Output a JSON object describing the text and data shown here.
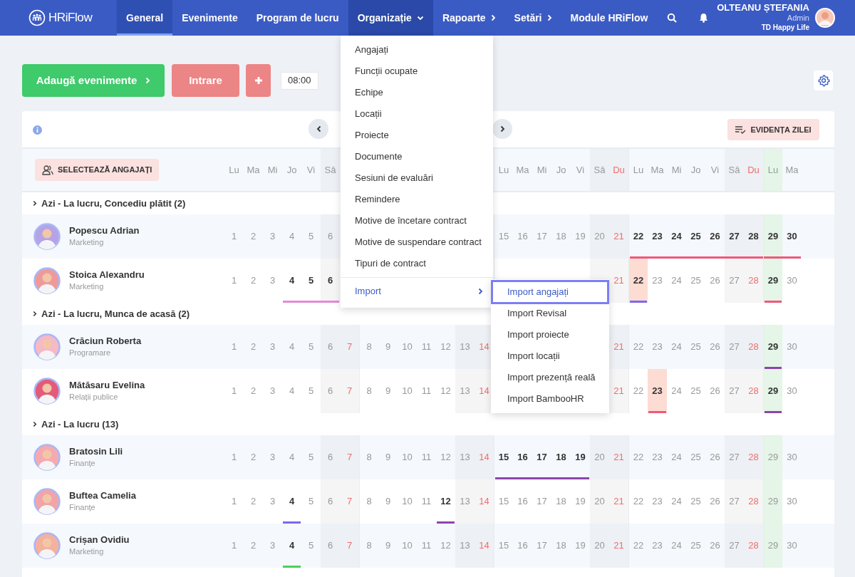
{
  "header": {
    "logo_text": "HRiFlow",
    "nav": [
      {
        "label": "General",
        "kind": "link",
        "selected": true,
        "expanded": false
      },
      {
        "label": "Evenimente",
        "kind": "link",
        "selected": false,
        "expanded": false
      },
      {
        "label": "Program de lucru",
        "kind": "link",
        "selected": false,
        "expanded": false
      },
      {
        "label": "Organizație",
        "kind": "dropdown",
        "selected": false,
        "expanded": true
      },
      {
        "label": "Rapoarte",
        "kind": "submenu",
        "selected": false,
        "expanded": false
      },
      {
        "label": "Setări",
        "kind": "submenu",
        "selected": false,
        "expanded": false
      },
      {
        "label": "Module HRiFlow",
        "kind": "link",
        "selected": false,
        "expanded": false
      }
    ],
    "user": {
      "name": "OLTEANU ȘTEFANIA",
      "role": "Admin",
      "company": "TD Happy Life"
    }
  },
  "toolbar": {
    "add_events": "Adaugă evenimente",
    "check_in": "Intrare",
    "time": "08:00"
  },
  "calendar": {
    "summary_button": "EVIDENȚA ZILEI",
    "select_button": "SELECTEAZĂ ANGAJAȚI",
    "columns": [
      {
        "label": "Lu",
        "kind": "weekday",
        "today": false
      },
      {
        "label": "Ma",
        "kind": "weekday",
        "today": false
      },
      {
        "label": "Mi",
        "kind": "weekday",
        "today": false
      },
      {
        "label": "Jo",
        "kind": "weekday",
        "today": false
      },
      {
        "label": "Vi",
        "kind": "weekday",
        "today": false
      },
      {
        "label": "Sâ",
        "kind": "saturday",
        "today": false
      },
      {
        "kind": "sunday",
        "today": false
      },
      {
        "kind": "weekday",
        "today": false
      },
      {
        "kind": "weekday",
        "today": false
      },
      {
        "kind": "weekday",
        "today": false
      },
      {
        "kind": "weekday",
        "today": false
      },
      {
        "kind": "weekday",
        "today": false
      },
      {
        "kind": "saturday",
        "today": false
      },
      {
        "kind": "sunday",
        "today": false
      },
      {
        "label": "Lu",
        "kind": "weekday",
        "today": false
      },
      {
        "label": "Ma",
        "kind": "weekday",
        "today": false
      },
      {
        "label": "Mi",
        "kind": "weekday",
        "today": false
      },
      {
        "label": "Jo",
        "kind": "weekday",
        "today": false
      },
      {
        "label": "Vi",
        "kind": "weekday",
        "today": false
      },
      {
        "label": "Sâ",
        "kind": "saturday",
        "today": false
      },
      {
        "label": "Du",
        "kind": "sunday",
        "today": false
      },
      {
        "label": "Lu",
        "kind": "weekday",
        "today": false
      },
      {
        "label": "Ma",
        "kind": "weekday",
        "today": false
      },
      {
        "label": "Mi",
        "kind": "weekday",
        "today": false
      },
      {
        "label": "Jo",
        "kind": "weekday",
        "today": false
      },
      {
        "label": "Vi",
        "kind": "weekday",
        "today": false
      },
      {
        "label": "Sâ",
        "kind": "saturday",
        "today": false
      },
      {
        "label": "Du",
        "kind": "sunday",
        "today": false
      },
      {
        "label": "Lu",
        "kind": "weekday",
        "today": true
      },
      {
        "label": "Ma",
        "kind": "weekday",
        "today": false
      }
    ],
    "groups": [
      {
        "title": "Azi - La lucru, Concediu plătit (2)",
        "employees": [
          {
            "name": "Popescu Adrian",
            "department": "Marketing",
            "kind": "menu",
            "days": [
              {
                "date": "1",
                "highlighted": false
              },
              {
                "date": "2",
                "highlighted": false
              },
              {
                "date": "3",
                "highlighted": false
              },
              {
                "date": "4",
                "highlighted": false
              },
              {
                "date": "5",
                "highlighted": false
              },
              {
                "date": "6",
                "highlighted": false
              },
              {
                "date": "15",
                "highlighted": false
              },
              {
                "date": "16",
                "highlighted": false
              },
              {
                "date": "17",
                "highlighted": false
              },
              {
                "date": "18",
                "highlighted": false
              },
              {
                "date": "19",
                "highlighted": false
              },
              {
                "date": "20",
                "highlighted": false
              },
              {
                "date": "21",
                "highlighted": false
              },
              {
                "date": "22",
                "highlighted": false,
                "color": "#f0587a"
              },
              {
                "date": "23",
                "highlighted": false,
                "color": "#f0587a"
              },
              {
                "date": "24",
                "highlighted": false,
                "color": "#f0587a"
              },
              {
                "date": "25",
                "highlighted": false,
                "color": "#f0587a"
              },
              {
                "date": "26",
                "highlighted": false,
                "color": "#f0587a"
              },
              {
                "date": "27",
                "highlighted": false,
                "color": "#f0587a"
              },
              {
                "date": "28",
                "highlighted": false,
                "color": "#f0587a"
              },
              {
                "date": "29",
                "highlighted": false,
                "color": "#f0587a"
              },
              {
                "date": "30",
                "highlighted": false,
                "color": "#f0587a"
              }
            ]
          },
          {
            "name": "Stoica Alexandru",
            "department": "Marketing",
            "kind": "both",
            "days": [
              {
                "date": "1",
                "highlighted": false
              },
              {
                "date": "2",
                "highlighted": false
              },
              {
                "date": "3",
                "highlighted": false
              },
              {
                "date": "4",
                "highlighted": false,
                "color": "#e589d6"
              },
              {
                "date": "5",
                "highlighted": false,
                "color": "#e589d6"
              },
              {
                "date": "6",
                "highlighted": false,
                "color": "#e589d6"
              },
              {
                "date": "21",
                "highlighted": false
              },
              {
                "date": "22",
                "highlighted": true,
                "color": "#7b68ee"
              },
              {
                "date": "23",
                "highlighted": false
              },
              {
                "date": "24",
                "highlighted": false
              },
              {
                "date": "25",
                "highlighted": false
              },
              {
                "date": "26",
                "highlighted": false
              },
              {
                "date": "27",
                "highlighted": false
              },
              {
                "date": "28",
                "highlighted": false
              },
              {
                "date": "29",
                "highlighted": false,
                "color": "#f0587a"
              },
              {
                "date": "30",
                "highlighted": false
              }
            ]
          }
        ]
      },
      {
        "title": "Azi - La lucru, Munca de acasă (2)",
        "employees": [
          {
            "name": "Crăciun Roberta",
            "department": "Programare",
            "kind": "submenu",
            "days": [
              {
                "date": "1",
                "highlighted": false
              },
              {
                "date": "2",
                "highlighted": false
              },
              {
                "date": "3",
                "highlighted": false
              },
              {
                "date": "4",
                "highlighted": false
              },
              {
                "date": "5",
                "highlighted": false
              },
              {
                "date": "6",
                "highlighted": false
              },
              {
                "date": "7",
                "highlighted": false
              },
              {
                "date": "8",
                "highlighted": false
              },
              {
                "date": "9",
                "highlighted": false
              },
              {
                "date": "10",
                "highlighted": false
              },
              {
                "date": "11",
                "highlighted": false
              },
              {
                "date": "12",
                "highlighted": false
              },
              {
                "date": "13",
                "highlighted": false
              },
              {
                "date": "14",
                "highlighted": false
              },
              {
                "date": "21",
                "highlighted": false
              },
              {
                "date": "22",
                "highlighted": false
              },
              {
                "date": "23",
                "highlighted": false
              },
              {
                "date": "24",
                "highlighted": false
              },
              {
                "date": "25",
                "highlighted": false
              },
              {
                "date": "26",
                "highlighted": false
              },
              {
                "date": "27",
                "highlighted": false
              },
              {
                "date": "28",
                "highlighted": false
              },
              {
                "date": "29",
                "highlighted": false,
                "color": "#8e44ad"
              },
              {
                "date": "30",
                "highlighted": false
              }
            ]
          },
          {
            "name": "Mătăsaru Evelina",
            "department": "Relații publice",
            "kind": "submenu",
            "days": [
              {
                "date": "1",
                "highlighted": false
              },
              {
                "date": "2",
                "highlighted": false
              },
              {
                "date": "3",
                "highlighted": false
              },
              {
                "date": "4",
                "highlighted": false
              },
              {
                "date": "5",
                "highlighted": false
              },
              {
                "date": "6",
                "highlighted": false
              },
              {
                "date": "7",
                "highlighted": false
              },
              {
                "date": "8",
                "highlighted": false
              },
              {
                "date": "9",
                "highlighted": false
              },
              {
                "date": "10",
                "highlighted": false
              },
              {
                "date": "11",
                "highlighted": false
              },
              {
                "date": "12",
                "highlighted": false
              },
              {
                "date": "13",
                "highlighted": false
              },
              {
                "date": "14",
                "highlighted": false
              },
              {
                "date": "21",
                "highlighted": false
              },
              {
                "date": "22",
                "highlighted": false
              },
              {
                "date": "23",
                "highlighted": true,
                "color": "#f0587a"
              },
              {
                "date": "24",
                "highlighted": false
              },
              {
                "date": "25",
                "highlighted": false
              },
              {
                "date": "26",
                "highlighted": false
              },
              {
                "date": "27",
                "highlighted": false
              },
              {
                "date": "28",
                "highlighted": false
              },
              {
                "date": "29",
                "highlighted": false,
                "color": "#8e44ad"
              },
              {
                "date": "30",
                "highlighted": false
              }
            ]
          }
        ]
      },
      {
        "title": "Azi - La lucru (13)",
        "employees": [
          {
            "name": "Bratosin Lili",
            "department": "Finanțe",
            "kind": "open",
            "days": [
              {
                "date": "1",
                "highlighted": false
              },
              {
                "date": "2",
                "highlighted": false
              },
              {
                "date": "3",
                "highlighted": false
              },
              {
                "date": "4",
                "highlighted": false
              },
              {
                "date": "5",
                "highlighted": false
              },
              {
                "date": "6",
                "highlighted": false
              },
              {
                "date": "7",
                "highlighted": false
              },
              {
                "date": "8",
                "highlighted": false
              },
              {
                "date": "9",
                "highlighted": false
              },
              {
                "date": "10",
                "highlighted": false
              },
              {
                "date": "11",
                "highlighted": false
              },
              {
                "date": "12",
                "highlighted": false
              },
              {
                "date": "13",
                "highlighted": false
              },
              {
                "date": "14",
                "highlighted": false
              },
              {
                "date": "15",
                "highlighted": false,
                "color": "#8e44ad"
              },
              {
                "date": "16",
                "highlighted": false,
                "color": "#8e44ad"
              },
              {
                "date": "17",
                "highlighted": false,
                "color": "#8e44ad"
              },
              {
                "date": "18",
                "highlighted": false,
                "color": "#8e44ad"
              },
              {
                "date": "19",
                "highlighted": false,
                "color": "#8e44ad"
              },
              {
                "date": "20",
                "highlighted": false
              },
              {
                "date": "21",
                "highlighted": false
              },
              {
                "date": "22",
                "highlighted": false
              },
              {
                "date": "23",
                "highlighted": false
              },
              {
                "date": "24",
                "highlighted": false
              },
              {
                "date": "25",
                "highlighted": false
              },
              {
                "date": "26",
                "highlighted": false
              },
              {
                "date": "27",
                "highlighted": false
              },
              {
                "date": "28",
                "highlighted": false
              },
              {
                "date": "29",
                "highlighted": false
              },
              {
                "date": "30",
                "highlighted": false
              }
            ]
          },
          {
            "name": "Buftea Camelia",
            "department": "Finanțe",
            "kind": "open",
            "days": [
              {
                "date": "1",
                "highlighted": false
              },
              {
                "date": "2",
                "highlighted": false
              },
              {
                "date": "3",
                "highlighted": false
              },
              {
                "date": "4",
                "highlighted": false,
                "color": "#7b68ee"
              },
              {
                "date": "5",
                "highlighted": false
              },
              {
                "date": "6",
                "highlighted": false
              },
              {
                "date": "7",
                "highlighted": false
              },
              {
                "date": "8",
                "highlighted": false
              },
              {
                "date": "9",
                "highlighted": false
              },
              {
                "date": "10",
                "highlighted": false
              },
              {
                "date": "11",
                "highlighted": false
              },
              {
                "date": "12",
                "highlighted": false,
                "color": "#8e44ad"
              },
              {
                "date": "13",
                "highlighted": false
              },
              {
                "date": "14",
                "highlighted": false
              },
              {
                "date": "15",
                "highlighted": false
              },
              {
                "date": "16",
                "highlighted": false
              },
              {
                "date": "17",
                "highlighted": false
              },
              {
                "date": "18",
                "highlighted": false
              },
              {
                "date": "19",
                "highlighted": false
              },
              {
                "date": "20",
                "highlighted": false
              },
              {
                "date": "21",
                "highlighted": false
              },
              {
                "date": "22",
                "highlighted": false
              },
              {
                "date": "23",
                "highlighted": false
              },
              {
                "date": "24",
                "highlighted": false
              },
              {
                "date": "25",
                "highlighted": false
              },
              {
                "date": "26",
                "highlighted": false
              },
              {
                "date": "27",
                "highlighted": false
              },
              {
                "date": "28",
                "highlighted": false
              },
              {
                "date": "29",
                "highlighted": false
              },
              {
                "date": "30",
                "highlighted": false
              }
            ]
          },
          {
            "name": "Crișan Ovidiu",
            "department": "Marketing",
            "kind": "open",
            "days": [
              {
                "date": "1",
                "highlighted": false
              },
              {
                "date": "2",
                "highlighted": false
              },
              {
                "date": "3",
                "highlighted": false
              },
              {
                "date": "4",
                "highlighted": false,
                "color": "#4cd05b"
              },
              {
                "date": "5",
                "highlighted": false
              },
              {
                "date": "6",
                "highlighted": false
              },
              {
                "date": "7",
                "highlighted": false
              },
              {
                "date": "8",
                "highlighted": false
              },
              {
                "date": "9",
                "highlighted": false
              },
              {
                "date": "10",
                "highlighted": false
              },
              {
                "date": "11",
                "highlighted": false
              },
              {
                "date": "12",
                "highlighted": false
              },
              {
                "date": "13",
                "highlighted": false
              },
              {
                "date": "14",
                "highlighted": false
              },
              {
                "date": "15",
                "highlighted": false
              },
              {
                "date": "16",
                "highlighted": false
              },
              {
                "date": "17",
                "highlighted": false
              },
              {
                "date": "18",
                "highlighted": false
              },
              {
                "date": "19",
                "highlighted": false
              },
              {
                "date": "20",
                "highlighted": false
              },
              {
                "date": "21",
                "highlighted": false
              },
              {
                "date": "22",
                "highlighted": false
              },
              {
                "date": "23",
                "highlighted": false
              },
              {
                "date": "24",
                "highlighted": false
              },
              {
                "date": "25",
                "highlighted": false
              },
              {
                "date": "26",
                "highlighted": false
              },
              {
                "date": "27",
                "highlighted": false
              },
              {
                "date": "28",
                "highlighted": false
              },
              {
                "date": "29",
                "highlighted": false
              },
              {
                "date": "30",
                "highlighted": false
              }
            ]
          }
        ]
      }
    ]
  },
  "organization_menu": {
    "items": [
      {
        "label": "Angajați",
        "kind": "item",
        "expanded": false
      },
      {
        "label": "Funcții ocupate",
        "kind": "item",
        "expanded": false
      },
      {
        "label": "Echipe",
        "kind": "item",
        "expanded": false
      },
      {
        "label": "Locații",
        "kind": "item",
        "expanded": false
      },
      {
        "label": "Proiecte",
        "kind": "item",
        "expanded": false
      },
      {
        "label": "Documente",
        "kind": "item",
        "expanded": false
      },
      {
        "label": "Sesiuni de evaluări",
        "kind": "item",
        "expanded": false
      },
      {
        "label": "Remindere",
        "kind": "item",
        "expanded": false
      },
      {
        "label": "Motive de încetare contract",
        "kind": "item",
        "expanded": false
      },
      {
        "label": "Motive de suspendare contract",
        "kind": "item",
        "expanded": false
      },
      {
        "label": "Tipuri de contract",
        "kind": "item",
        "expanded": false
      },
      {
        "label": "Import",
        "kind": "submenu",
        "expanded": true
      }
    ],
    "submenu": [
      {
        "label": "Import angajați",
        "selected": true
      },
      {
        "label": "Import Revisal",
        "selected": false
      },
      {
        "label": "Import proiecte",
        "selected": false
      },
      {
        "label": "Import locații",
        "selected": false
      },
      {
        "label": "Import prezență reală",
        "selected": false
      },
      {
        "label": "Import BambooHR",
        "selected": false
      }
    ]
  }
}
